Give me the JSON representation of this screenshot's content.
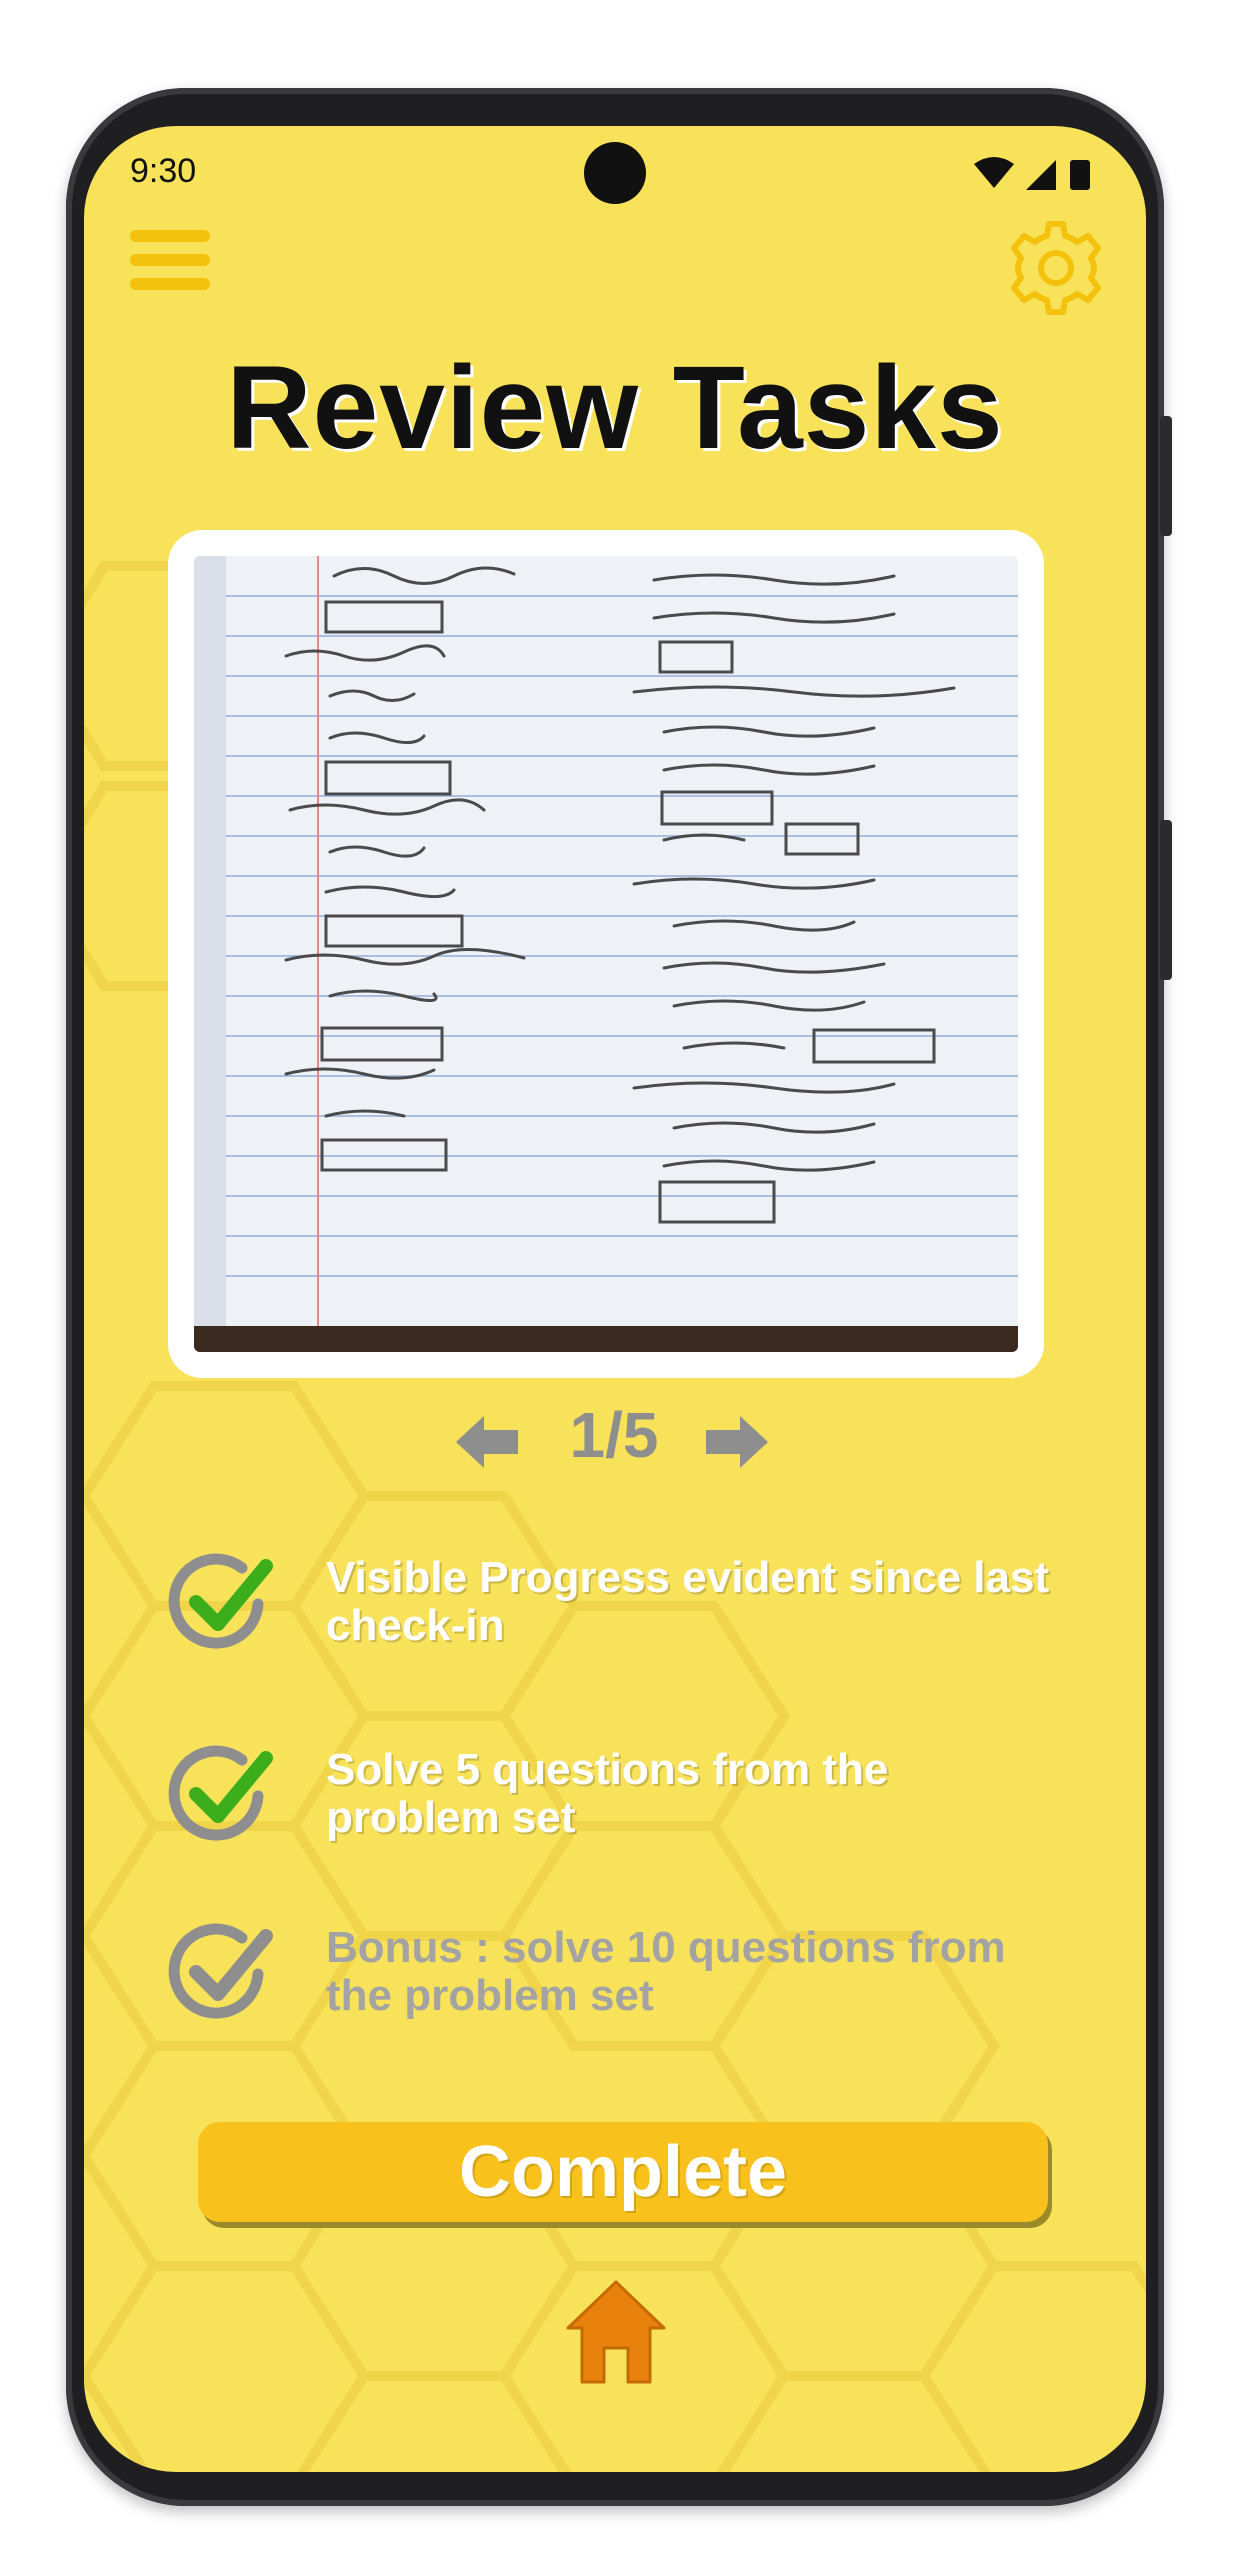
{
  "status_bar": {
    "time": "9:30"
  },
  "header": {
    "title": "Review Tasks"
  },
  "photo": {
    "icon": "homework-photo"
  },
  "pager": {
    "label": "1/5"
  },
  "tasks": [
    {
      "label": "Visible Progress evident since last check-in",
      "checked": true
    },
    {
      "label": "Solve 5 questions from the problem set",
      "checked": true
    },
    {
      "label": "Bonus : solve 10 questions from the problem set",
      "checked": false
    }
  ],
  "actions": {
    "complete_label": "Complete"
  },
  "colors": {
    "background": "#f7e25a",
    "accent": "#f9c11c",
    "check_green": "#3cae1c",
    "muted_gray": "#8e8e8e",
    "home_orange": "#e8820c"
  }
}
